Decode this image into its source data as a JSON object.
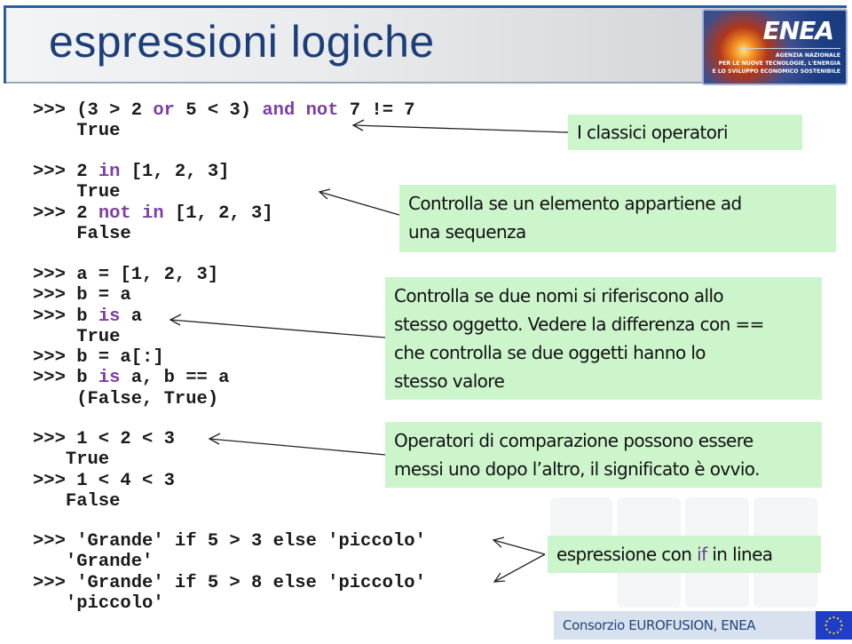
{
  "slide": {
    "title": "espressioni logiche",
    "logo": {
      "word": "ENEA",
      "subtitle_lines": [
        "AGENZIA NAZIONALE",
        "PER LE NUOVE TECNOLOGIE, L'ENERGIA",
        "E LO SVILUPPO ECONOMICO SOSTENIBILE"
      ]
    },
    "code_blocks": [
      {
        "lines": [
          [
            {
              "t": ">>> (3 > 2 "
            },
            {
              "t": "or",
              "kw": true
            },
            {
              "t": " 5 < 3) "
            },
            {
              "t": "and",
              "kw": true
            },
            {
              "t": " "
            },
            {
              "t": "not",
              "kw": true
            },
            {
              "t": " 7 != 7"
            }
          ],
          [
            {
              "t": "    True"
            }
          ]
        ]
      },
      {
        "lines": [
          [
            {
              "t": ">>> 2 "
            },
            {
              "t": "in",
              "kw": true
            },
            {
              "t": " [1, 2, 3]"
            }
          ],
          [
            {
              "t": "    True"
            }
          ],
          [
            {
              "t": ">>> 2 "
            },
            {
              "t": "not",
              "kw": true
            },
            {
              "t": " "
            },
            {
              "t": "in",
              "kw": true
            },
            {
              "t": " [1, 2, 3]"
            }
          ],
          [
            {
              "t": "    False"
            }
          ]
        ]
      },
      {
        "lines": [
          [
            {
              "t": ">>> a = [1, 2, 3]"
            }
          ],
          [
            {
              "t": ">>> b = a"
            }
          ],
          [
            {
              "t": ">>> b "
            },
            {
              "t": "is",
              "kw": true
            },
            {
              "t": " a"
            }
          ],
          [
            {
              "t": "    True"
            }
          ],
          [
            {
              "t": ">>> b = a[:]"
            }
          ],
          [
            {
              "t": ">>> b "
            },
            {
              "t": "is",
              "kw": true
            },
            {
              "t": " a, b == a"
            }
          ],
          [
            {
              "t": "    (False, True)"
            }
          ]
        ]
      },
      {
        "lines": [
          [
            {
              "t": ">>> 1 < 2 < 3"
            }
          ],
          [
            {
              "t": "   True"
            }
          ],
          [
            {
              "t": ">>> 1 < 4 < 3"
            }
          ],
          [
            {
              "t": "   False"
            }
          ]
        ]
      },
      {
        "lines": [
          [
            {
              "t": ">>> 'Grande' if 5 > 3 else 'piccolo'"
            }
          ],
          [
            {
              "t": "   'Grande'"
            }
          ],
          [
            {
              "t": ">>> 'Grande' if 5 > 8 else 'piccolo'"
            }
          ],
          [
            {
              "t": "   'piccolo'"
            }
          ]
        ]
      }
    ],
    "notes": {
      "operators": "I classici operatori",
      "membership": [
        "Controlla se un elemento appartiene ad",
        "una sequenza"
      ],
      "identity": [
        "Controlla se due nomi si riferiscono allo",
        "stesso oggetto. Vedere la differenza con ==",
        "che controlla se due oggetti hanno lo",
        "stesso valore"
      ],
      "comparison": [
        "Operatori di comparazione possono essere",
        "messi uno dopo l’altro, il significato è ovvio."
      ],
      "inline_if": {
        "before": "espressione con ",
        "keyword": "if",
        "after": " in linea"
      }
    },
    "footer": {
      "text": "Consorzio EUROFUSION, ENEA",
      "flag": "eu-flag-icon"
    },
    "colors": {
      "title": "#1c3f7a",
      "keyword": "#7b3fa6",
      "note_bg": "#ccf5cc",
      "footer_bg": "#d8e2ee",
      "header_border": "#2a5ea3"
    }
  }
}
